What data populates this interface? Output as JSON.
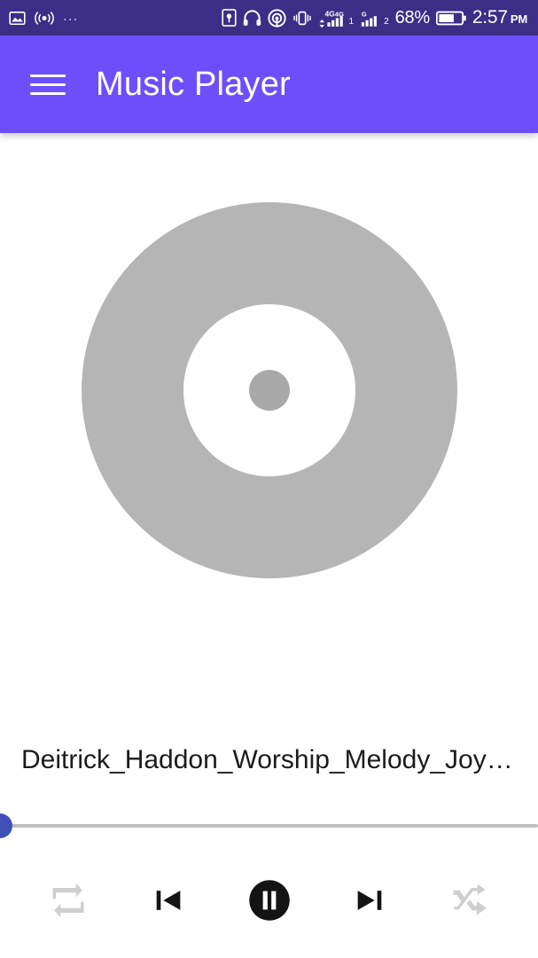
{
  "status_bar": {
    "background": "#3c2e86",
    "left_icons": [
      {
        "name": "image-icon",
        "label": "Screenshot saved"
      },
      {
        "name": "hotspot-icon",
        "label": "Portable hotspot on"
      },
      {
        "name": "more-notifications-icon",
        "label": "..."
      }
    ],
    "right_icons": [
      {
        "name": "id-badge-icon",
        "label": "Account"
      },
      {
        "name": "headphones-icon",
        "label": "Headphones connected"
      },
      {
        "name": "location-icon",
        "label": "Location active"
      },
      {
        "name": "vibrate-icon",
        "label": "Vibrate mode"
      }
    ],
    "signal_1": {
      "network": "4G",
      "network_secondary": "4G",
      "sim_label": "1",
      "bars": 4
    },
    "signal_2": {
      "network": "G",
      "sim_label": "2",
      "bars": 4
    },
    "battery_percent": "68%",
    "time": "2:57",
    "meridiem": "PM"
  },
  "app_bar": {
    "background": "#6c4ffa",
    "menu_icon": "hamburger-icon",
    "title": "Music Player"
  },
  "album_art": {
    "type": "vinyl-disc-placeholder",
    "disc_color": "#b5b5b5",
    "hole_color": "#ffffff",
    "pin_color": "#a9a9a9"
  },
  "now_playing": {
    "track_title": "Deitrick_Haddon_Worship_Melody_Joy…"
  },
  "seek_bar": {
    "position_percent": 0,
    "track_color": "#bdbdbd",
    "thumb_color": "#4050b5"
  },
  "controls": {
    "repeat": {
      "label": "Repeat",
      "icon": "repeat-icon",
      "state": "inactive"
    },
    "previous": {
      "label": "Previous",
      "icon": "skip-previous-icon",
      "state": "active"
    },
    "play_pause": {
      "label": "Pause",
      "icon": "pause-icon",
      "state": "playing"
    },
    "next": {
      "label": "Next",
      "icon": "skip-next-icon",
      "state": "active"
    },
    "shuffle": {
      "label": "Shuffle",
      "icon": "shuffle-icon",
      "state": "inactive"
    }
  }
}
